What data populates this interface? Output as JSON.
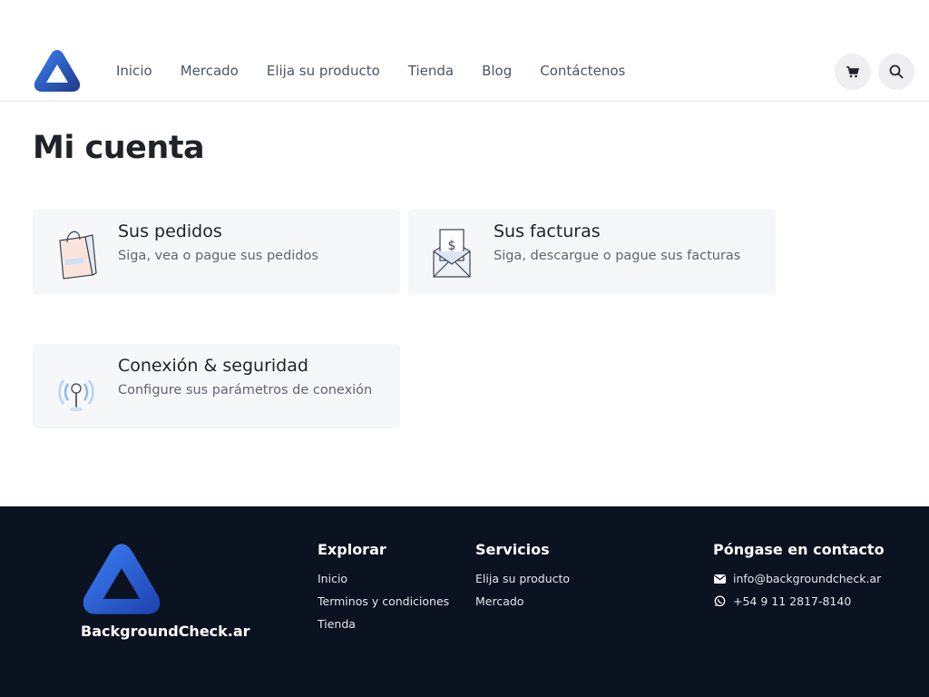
{
  "nav": {
    "items": [
      "Inicio",
      "Mercado",
      "Elija su producto",
      "Tienda",
      "Blog",
      "Contáctenos"
    ]
  },
  "header": {
    "cart_icon": "cart-icon",
    "search_icon": "search-icon"
  },
  "main": {
    "title": "Mi cuenta",
    "cards": [
      {
        "title": "Sus pedidos",
        "subtitle": "Siga, vea o pague sus pedidos",
        "icon": "shopping-bag-icon"
      },
      {
        "title": "Sus facturas",
        "subtitle": "Siga, descargue o pague sus facturas",
        "icon": "invoice-envelope-icon"
      },
      {
        "title": "Conexión & seguridad",
        "subtitle": "Configure sus parámetros de conexión",
        "icon": "signal-antenna-icon"
      }
    ]
  },
  "footer": {
    "brand": "BackgroundCheck.ar",
    "explore": {
      "heading": "Explorar",
      "links": [
        "Inicio",
        "Terminos y condiciones",
        "Tienda"
      ]
    },
    "services": {
      "heading": "Servicios",
      "links": [
        "Elija su producto",
        "Mercado"
      ]
    },
    "contact": {
      "heading": "Póngase en contacto",
      "email": "info@backgroundcheck.ar",
      "phone": "+54 9 11 2817-8140"
    }
  },
  "colors": {
    "accent": "#1d4ed8",
    "footer_bg": "#0b1220",
    "card_bg": "#f6f7f9"
  }
}
